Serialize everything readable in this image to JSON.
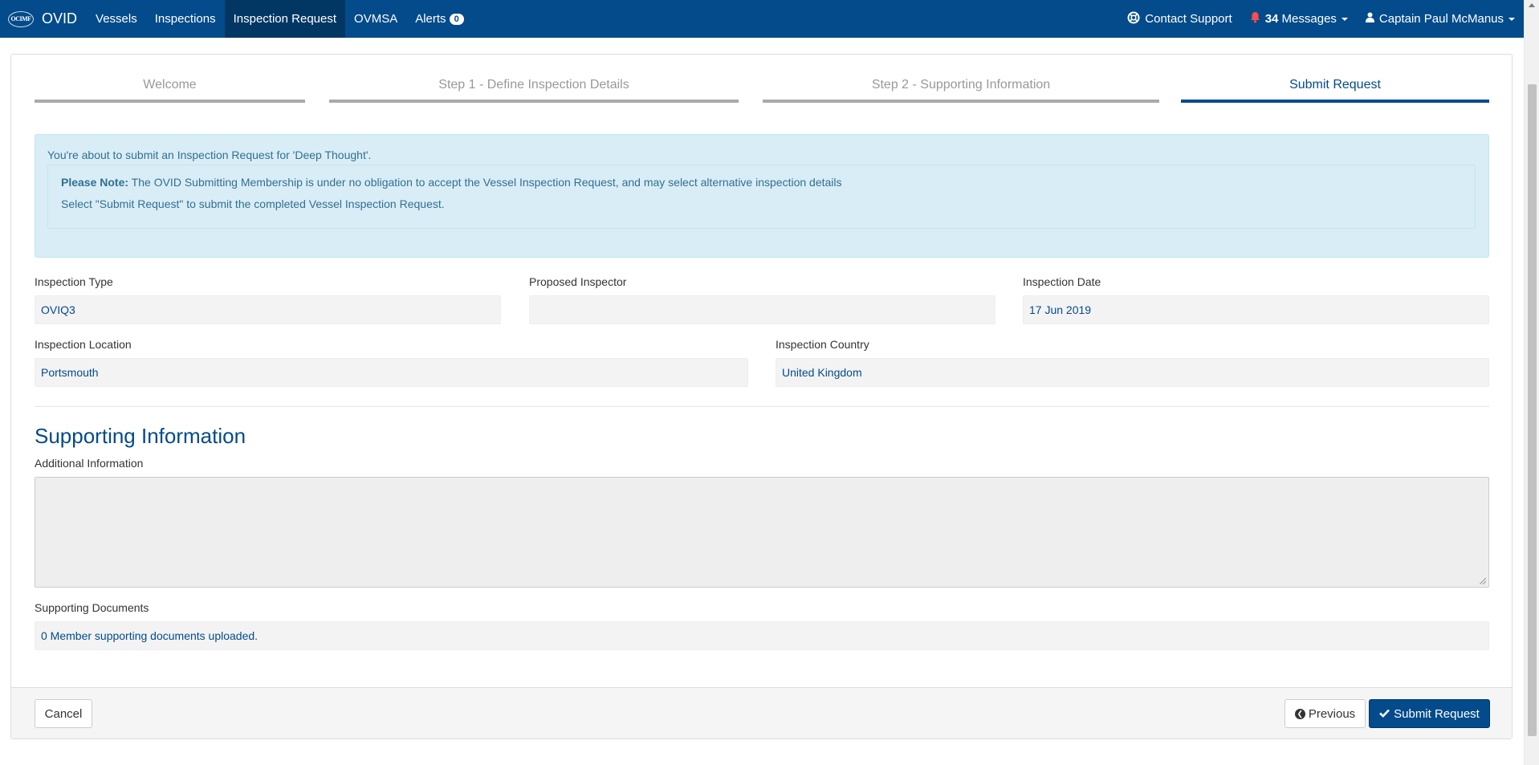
{
  "navbar": {
    "logo_text": "OCIMF",
    "brand": "OVID",
    "items": [
      {
        "label": "Vessels"
      },
      {
        "label": "Inspections"
      },
      {
        "label": "Inspection Request"
      },
      {
        "label": "OVMSA"
      },
      {
        "label": "Alerts"
      }
    ],
    "alerts_count": "0",
    "contact_support": "Contact Support",
    "messages_count": "34",
    "messages_label": "Messages",
    "user": "Captain Paul McManus",
    "icons": {
      "support": "lifebuoy-icon",
      "messages": "bell-icon",
      "user": "user-icon"
    },
    "colors": {
      "bar": "#034b8a",
      "active": "#023764",
      "bell": "#ff4d4d"
    }
  },
  "wizard": {
    "steps": [
      {
        "label": "Welcome"
      },
      {
        "label": "Step 1 - Define Inspection Details"
      },
      {
        "label": "Step 2 - Supporting Information"
      },
      {
        "label": "Submit Request"
      }
    ],
    "active_step": "Submit Request"
  },
  "alert": {
    "line1": "You're about to submit an Inspection Request for 'Deep Thought'.",
    "note_prefix": "Please Note:",
    "note_text": " The OVID Submitting Membership is under no obligation to accept the Vessel Inspection Request, and may select alternative inspection details",
    "line3": "Select \"Submit Request\" to submit the completed Vessel Inspection Request."
  },
  "fields": {
    "inspection_type": {
      "label": "Inspection Type",
      "value": "OVIQ3"
    },
    "proposed_inspector": {
      "label": "Proposed Inspector",
      "value": ""
    },
    "inspection_date": {
      "label": "Inspection Date",
      "value": "17 Jun 2019"
    },
    "inspection_location": {
      "label": "Inspection Location",
      "value": "Portsmouth"
    },
    "inspection_country": {
      "label": "Inspection Country",
      "value": "United Kingdom"
    }
  },
  "supporting": {
    "title": "Supporting Information",
    "additional_label": "Additional Information",
    "additional_value": "",
    "documents_label": "Supporting Documents",
    "documents_value": "0 Member supporting documents uploaded."
  },
  "footer": {
    "cancel": "Cancel",
    "previous": "Previous",
    "submit": "Submit Request"
  }
}
